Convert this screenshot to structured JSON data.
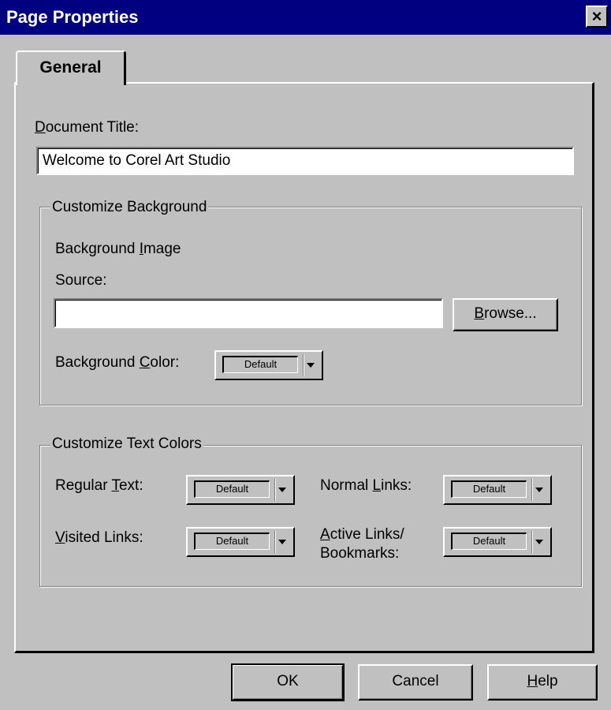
{
  "window": {
    "title": "Page Properties",
    "close_symbol": "×"
  },
  "tabs": [
    {
      "label": "General",
      "selected": true
    }
  ],
  "general": {
    "document_title_label_prefix": "",
    "document_title_label_mnemonic": "D",
    "document_title_label_rest": "ocument Title:",
    "document_title_value": "Welcome to Corel Art Studio"
  },
  "background_group": {
    "legend": "Customize Background",
    "image_label_pre": "Background ",
    "image_label_mnemonic": "I",
    "image_label_rest": "mage",
    "source_label": "Source:",
    "source_value": "",
    "browse_mnemonic": "B",
    "browse_rest": "rowse...",
    "color_label_pre": "Background ",
    "color_label_mnemonic": "C",
    "color_label_rest": "olor:",
    "color_value": "Default"
  },
  "text_colors_group": {
    "legend": "Customize Text Colors",
    "regular_pre": "Regular ",
    "regular_mnemonic": "T",
    "regular_rest": "ext:",
    "regular_value": "Default",
    "normal_links_pre": "Normal ",
    "normal_links_mnemonic": "L",
    "normal_links_rest": "inks:",
    "normal_links_value": "Default",
    "visited_mnemonic": "V",
    "visited_rest": "isited Links:",
    "visited_value": "Default",
    "active_mnemonic": "A",
    "active_rest_line1": "ctive Links/",
    "active_line2": "Bookmarks:",
    "active_value": "Default"
  },
  "buttons": {
    "ok": "OK",
    "cancel": "Cancel",
    "help_mnemonic": "H",
    "help_rest": "elp"
  },
  "colors": {
    "titlebar": "#000080",
    "face": "#c0c0c0"
  },
  "icons": {
    "close": "close-icon",
    "dropdown": "chevron-down-icon"
  }
}
